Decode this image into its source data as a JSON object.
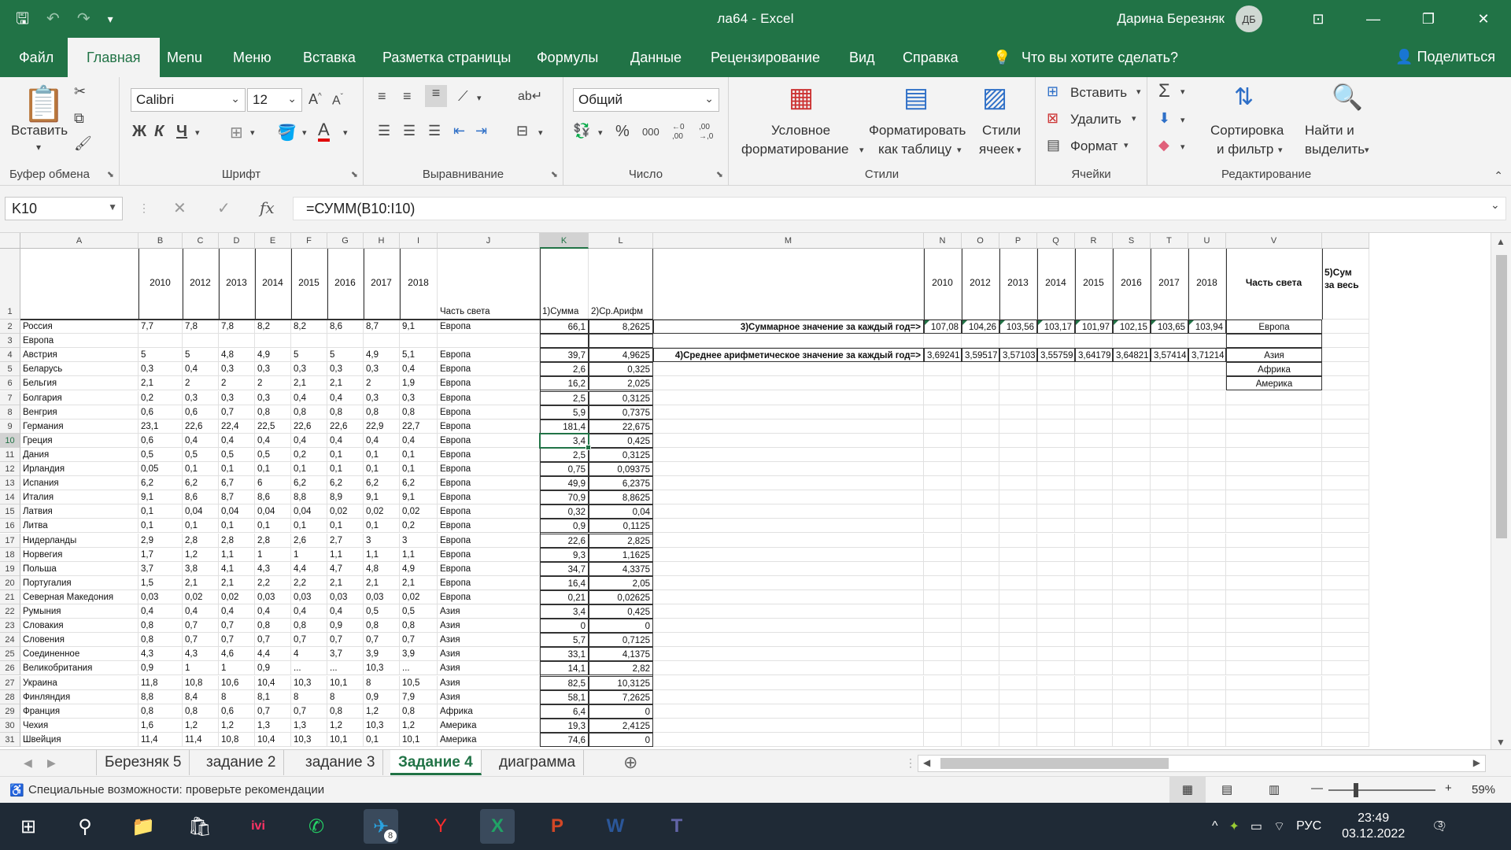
{
  "window": {
    "title": "ла64  -  Excel",
    "user": "Дарина Березняк",
    "avatar_initials": "ДБ"
  },
  "menu": {
    "tabs": [
      "Файл",
      "Главная",
      "Menu",
      "Меню",
      "Вставка",
      "Разметка страницы",
      "Формулы",
      "Данные",
      "Рецензирование",
      "Вид",
      "Справка"
    ],
    "tell_me": "Что вы хотите сделать?",
    "share": "Поделиться"
  },
  "ribbon": {
    "clipboard": {
      "label": "Буфер обмена",
      "paste": "Вставить"
    },
    "font": {
      "label": "Шрифт",
      "name": "Calibri",
      "size": "12",
      "bold": "Ж",
      "italic": "К",
      "underline": "Ч"
    },
    "alignment": {
      "label": "Выравнивание"
    },
    "number": {
      "label": "Число",
      "format": "Общий",
      "percent": "%",
      "thousands": "000",
      "inc_dec": "←0 ,00",
      "dec_dec": ",00 →,0"
    },
    "styles": {
      "label": "Стили",
      "conditional": "Условное\nформатирование",
      "cond_l1": "Условное",
      "cond_l2": "форматирование",
      "table_l1": "Форматировать",
      "table_l2": "как таблицу",
      "cell_l1": "Стили",
      "cell_l2": "ячеек"
    },
    "cells": {
      "label": "Ячейки",
      "insert": "Вставить",
      "delete": "Удалить",
      "format": "Формат"
    },
    "editing": {
      "label": "Редактирование",
      "sort_l1": "Сортировка",
      "sort_l2": "и фильтр",
      "find_l1": "Найти и",
      "find_l2": "выделить"
    }
  },
  "formula_bar": {
    "name_box": "K10",
    "formula": "=СУММ(B10:I10)"
  },
  "sheet": {
    "columns": [
      "A",
      "B",
      "C",
      "D",
      "E",
      "F",
      "G",
      "H",
      "I",
      "J",
      "K",
      "L",
      "M",
      "N",
      "O",
      "P",
      "Q",
      "R",
      "S",
      "T",
      "U",
      "V"
    ],
    "header_row": {
      "years": [
        "2010",
        "2012",
        "2013",
        "2014",
        "2015",
        "2016",
        "2017",
        "2018"
      ],
      "j": "Часть света",
      "k": "1)Сумма",
      "l": "2)Ср.Арифм",
      "right_years": [
        "2010",
        "2012",
        "2013",
        "2014",
        "2015",
        "2016",
        "2017",
        "2018"
      ],
      "v": "Часть света",
      "w1": "5)Сум",
      "w2": "за весь"
    },
    "rows": [
      [
        "Россия",
        "7,7",
        "7,8",
        "7,8",
        "8,2",
        "8,2",
        "8,6",
        "8,7",
        "9,1",
        "Европа",
        "66,1",
        "8,2625"
      ],
      [
        "Европа",
        "",
        "",
        "",
        "",
        "",
        "",
        "",
        "",
        "",
        "",
        ""
      ],
      [
        "Австрия",
        "5",
        "5",
        "4,8",
        "4,9",
        "5",
        "5",
        "4,9",
        "5,1",
        "Европа",
        "39,7",
        "4,9625"
      ],
      [
        "Беларусь",
        "0,3",
        "0,4",
        "0,3",
        "0,3",
        "0,3",
        "0,3",
        "0,3",
        "0,4",
        "Европа",
        "2,6",
        "0,325"
      ],
      [
        "Бельгия",
        "2,1",
        "2",
        "2",
        "2",
        "2,1",
        "2,1",
        "2",
        "1,9",
        "Европа",
        "16,2",
        "2,025"
      ],
      [
        "Болгария",
        "0,2",
        "0,3",
        "0,3",
        "0,3",
        "0,4",
        "0,4",
        "0,3",
        "0,3",
        "Европа",
        "2,5",
        "0,3125"
      ],
      [
        "Венгрия",
        "0,6",
        "0,6",
        "0,7",
        "0,8",
        "0,8",
        "0,8",
        "0,8",
        "0,8",
        "Европа",
        "5,9",
        "0,7375"
      ],
      [
        "Германия",
        "23,1",
        "22,6",
        "22,4",
        "22,5",
        "22,6",
        "22,6",
        "22,9",
        "22,7",
        "Европа",
        "181,4",
        "22,675"
      ],
      [
        "Греция",
        "0,6",
        "0,4",
        "0,4",
        "0,4",
        "0,4",
        "0,4",
        "0,4",
        "0,4",
        "Европа",
        "3,4",
        "0,425"
      ],
      [
        "Дания",
        "0,5",
        "0,5",
        "0,5",
        "0,5",
        "0,2",
        "0,1",
        "0,1",
        "0,1",
        "Европа",
        "2,5",
        "0,3125"
      ],
      [
        "Ирландия",
        "0,05",
        "0,1",
        "0,1",
        "0,1",
        "0,1",
        "0,1",
        "0,1",
        "0,1",
        "Европа",
        "0,75",
        "0,09375"
      ],
      [
        "Испания",
        "6,2",
        "6,2",
        "6,7",
        "6",
        "6,2",
        "6,2",
        "6,2",
        "6,2",
        "Европа",
        "49,9",
        "6,2375"
      ],
      [
        "Италия",
        "9,1",
        "8,6",
        "8,7",
        "8,6",
        "8,8",
        "8,9",
        "9,1",
        "9,1",
        "Европа",
        "70,9",
        "8,8625"
      ],
      [
        "Латвия",
        "0,1",
        "0,04",
        "0,04",
        "0,04",
        "0,04",
        "0,02",
        "0,02",
        "0,02",
        "Европа",
        "0,32",
        "0,04"
      ],
      [
        "Литва",
        "0,1",
        "0,1",
        "0,1",
        "0,1",
        "0,1",
        "0,1",
        "0,1",
        "0,2",
        "Европа",
        "0,9",
        "0,1125"
      ],
      [
        "Нидерланды",
        "2,9",
        "2,8",
        "2,8",
        "2,8",
        "2,6",
        "2,7",
        "3",
        "3",
        "Европа",
        "22,6",
        "2,825"
      ],
      [
        "Норвегия",
        "1,7",
        "1,2",
        "1,1",
        "1",
        "1",
        "1,1",
        "1,1",
        "1,1",
        "Европа",
        "9,3",
        "1,1625"
      ],
      [
        "Польша",
        "3,7",
        "3,8",
        "4,1",
        "4,3",
        "4,4",
        "4,7",
        "4,8",
        "4,9",
        "Европа",
        "34,7",
        "4,3375"
      ],
      [
        "Португалия",
        "1,5",
        "2,1",
        "2,1",
        "2,2",
        "2,2",
        "2,1",
        "2,1",
        "2,1",
        "Европа",
        "16,4",
        "2,05"
      ],
      [
        "Северная Македония",
        "0,03",
        "0,02",
        "0,02",
        "0,03",
        "0,03",
        "0,03",
        "0,03",
        "0,02",
        "Европа",
        "0,21",
        "0,02625"
      ],
      [
        "Румыния",
        "0,4",
        "0,4",
        "0,4",
        "0,4",
        "0,4",
        "0,4",
        "0,5",
        "0,5",
        "Азия",
        "3,4",
        "0,425"
      ],
      [
        "Словакия",
        "0,8",
        "0,7",
        "0,7",
        "0,8",
        "0,8",
        "0,9",
        "0,8",
        "0,8",
        "Азия",
        "0",
        "0"
      ],
      [
        "Словения",
        "0,8",
        "0,7",
        "0,7",
        "0,7",
        "0,7",
        "0,7",
        "0,7",
        "0,7",
        "Азия",
        "5,7",
        "0,7125"
      ],
      [
        "Соединенное",
        "4,3",
        "4,3",
        "4,6",
        "4,4",
        "4",
        "3,7",
        "3,9",
        "3,9",
        "Азия",
        "33,1",
        "4,1375"
      ],
      [
        "Великобритания",
        "0,9",
        "1",
        "1",
        "0,9",
        "...",
        "...",
        "10,3",
        "...",
        "Азия",
        "14,1",
        "2,82"
      ],
      [
        "Украина",
        "11,8",
        "10,8",
        "10,6",
        "10,4",
        "10,3",
        "10,1",
        "8",
        "10,5",
        "Азия",
        "82,5",
        "10,3125"
      ],
      [
        "Финляндия",
        "8,8",
        "8,4",
        "8",
        "8,1",
        "8",
        "8",
        "0,9",
        "7,9",
        "Азия",
        "58,1",
        "7,2625"
      ],
      [
        "Франция",
        "0,8",
        "0,8",
        "0,6",
        "0,7",
        "0,7",
        "0,8",
        "1,2",
        "0,8",
        "Африка",
        "6,4",
        "0"
      ],
      [
        "Чехия",
        "1,6",
        "1,2",
        "1,2",
        "1,3",
        "1,3",
        "1,2",
        "10,3",
        "1,2",
        "Америка",
        "19,3",
        "2,4125"
      ],
      [
        "Швейция",
        "11,4",
        "11,4",
        "10,8",
        "10,4",
        "10,3",
        "10,1",
        "0,1",
        "10,1",
        "Америка",
        "74,6",
        "0"
      ]
    ],
    "sum_label": "3)Суммарное значение за каждый год=>",
    "sum_values": [
      "107,08",
      "104,26",
      "103,56",
      "103,17",
      "101,97",
      "102,15",
      "103,65",
      "103,94"
    ],
    "avg_label": "4)Среднее арифметическое значение за каждый год=>",
    "avg_values": [
      "3,69241",
      "3,59517",
      "3,57103",
      "3,55759",
      "3,64179",
      "3,64821",
      "3,57414",
      "3,71214"
    ],
    "regions": [
      "Европа",
      "Азия",
      "Африка",
      "Америка"
    ]
  },
  "sheet_tabs": [
    "Березняк 5",
    "задание 2",
    "задание 3",
    "Задание 4",
    "диаграмма"
  ],
  "status": {
    "accessibility": "Специальные возможности: проверьте рекомендации",
    "zoom": "59%"
  },
  "taskbar": {
    "lang": "РУС",
    "time": "23:49",
    "date": "03.12.2022",
    "notif": "3",
    "telegram_badge": "8"
  }
}
